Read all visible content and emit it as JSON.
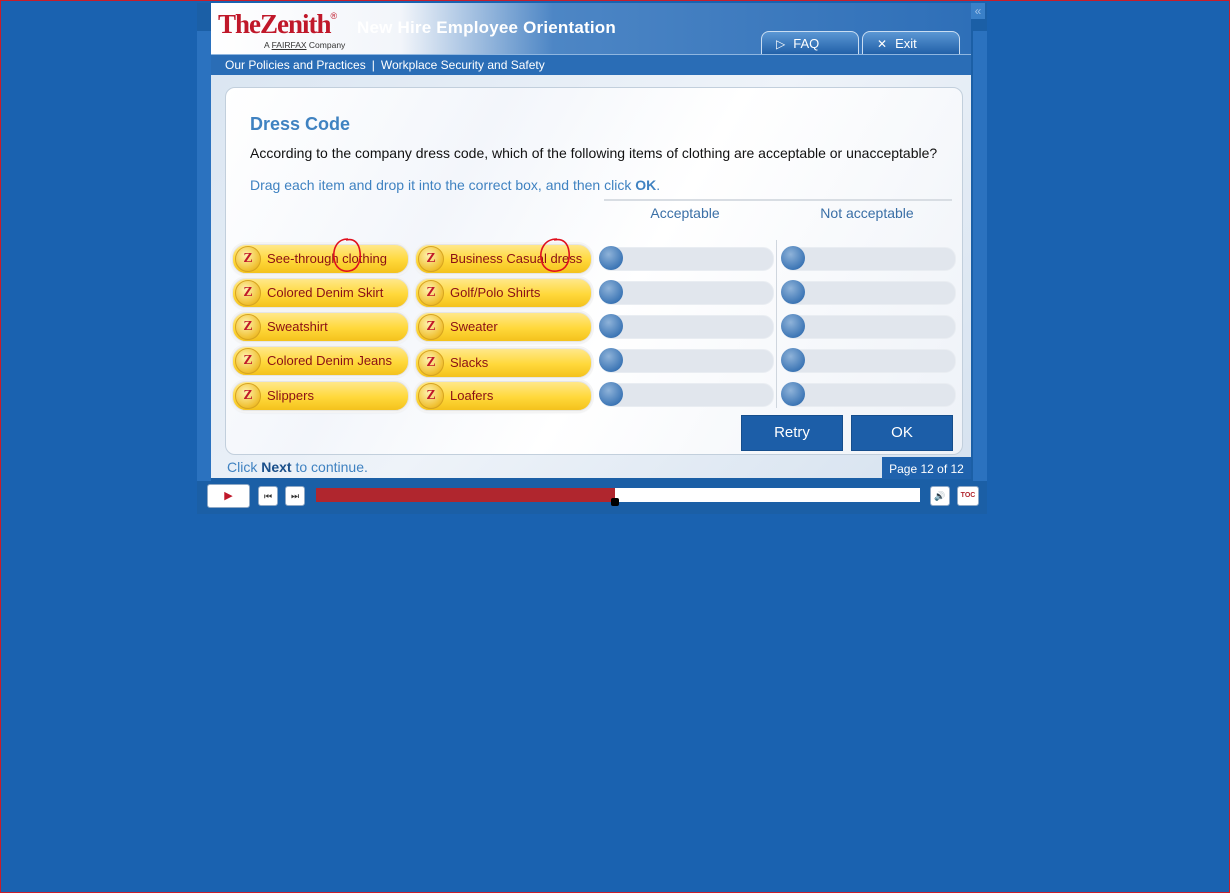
{
  "brand": {
    "logo_main": "TheZenith",
    "logo_tm": "®",
    "logo_sub_prefix": "A",
    "logo_sub_company": "FAIRFAX",
    "logo_sub_suffix": "Company",
    "app_title": "New Hire Employee Orientation"
  },
  "header": {
    "faq_label": "FAQ",
    "exit_label": "Exit",
    "faq_icon": "play-triangle-icon",
    "exit_icon": "close-icon",
    "collapse_icon": "double-chevron-left-icon"
  },
  "breadcrumb": {
    "section": "Our Policies and Practices",
    "separator": "|",
    "topic": "Workplace Security and Safety"
  },
  "activity": {
    "title": "Dress Code",
    "question": "According to the company dress code, which of the following items of clothing are acceptable or unacceptable?",
    "instruction_prefix": "Drag each item and drop it into the correct box, and then click ",
    "instruction_bold": "OK",
    "instruction_suffix": ".",
    "column_acceptable": "Acceptable",
    "column_not_acceptable": "Not acceptable",
    "items_left": [
      "See-through clothing",
      "Colored Denim Skirt",
      "Sweatshirt",
      "Colored Denim Jeans",
      "Slippers"
    ],
    "items_right": [
      "Business Casual dress",
      "Golf/Polo Shirts",
      "Sweater",
      "Slacks",
      "Loafers"
    ],
    "badge_letter": "Z",
    "retry_label": "Retry",
    "ok_label": "OK"
  },
  "footer": {
    "hint_prefix": "Click ",
    "hint_bold": "Next",
    "hint_suffix": " to continue.",
    "page_indicator": "Page 12 of 12"
  },
  "player": {
    "play_icon": "play-icon",
    "prev_icon": "skip-back-icon",
    "next_icon": "skip-forward-icon",
    "volume_icon": "speaker-icon",
    "toc_label": "TOC",
    "progress_fraction": 0.495
  },
  "colors": {
    "background": "#1a62b0",
    "accent": "#3f82c1",
    "brand_red": "#c0182a",
    "progress_fill": "#b0262e",
    "annotation_red": "#e0101e"
  }
}
